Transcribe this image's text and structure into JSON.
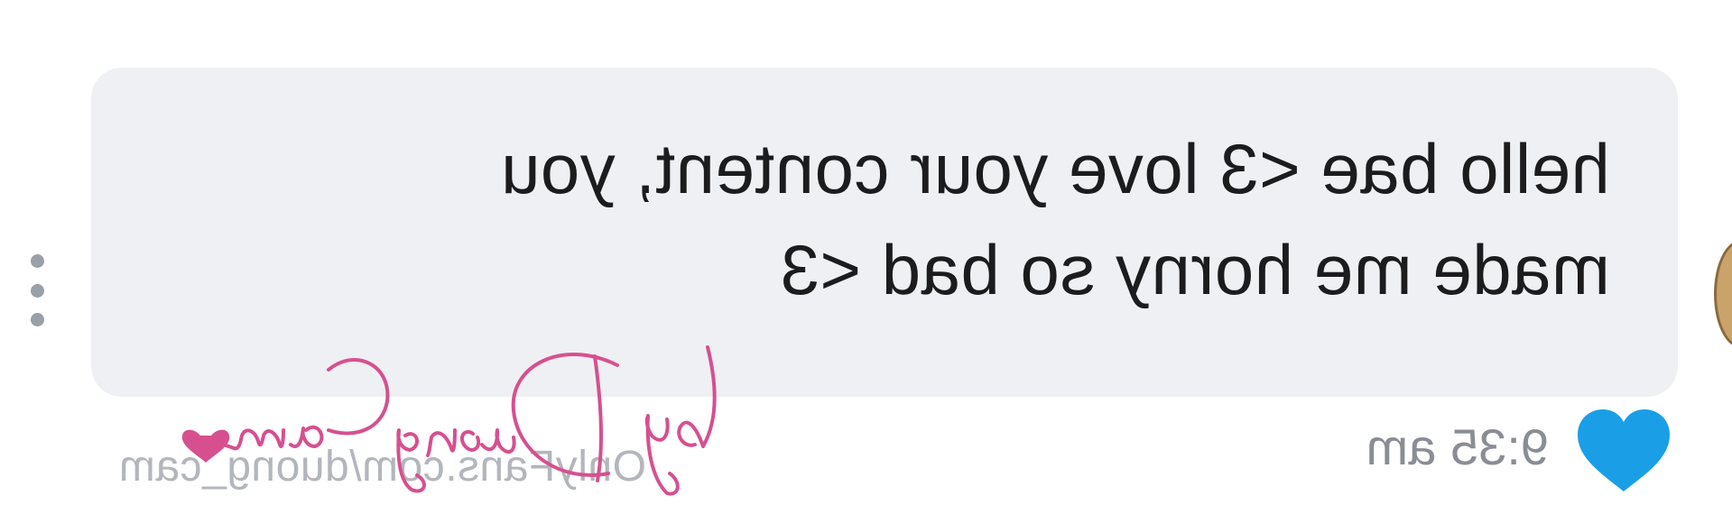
{
  "message": {
    "lines": [
      "hello bae <3 love your content, you",
      "made me horny so bad <3"
    ],
    "time": "9:35 am",
    "liked": true
  },
  "watermark": {
    "url": "OnlyFans.com/duong_cam",
    "signature": "by DuongCam"
  },
  "icons": {
    "menu": "vertical-ellipsis-icon",
    "like": "heart-icon"
  },
  "colors": {
    "bubble": "#eff0f3",
    "text": "#1c1c1e",
    "heart": "#1a9fe6",
    "timestamp": "#8a8d94",
    "watermark": "#b3b6bc",
    "signature": "#d6508f"
  }
}
